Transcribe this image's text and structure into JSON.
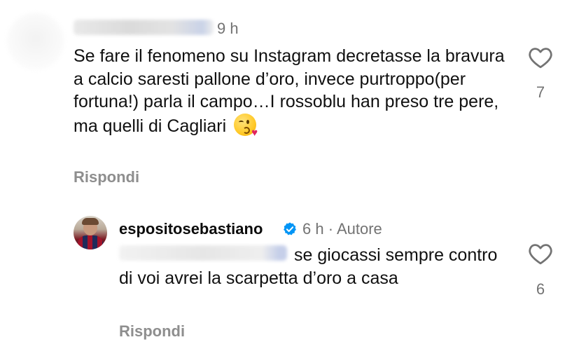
{
  "comments": [
    {
      "time": "9 h",
      "text": "Se fare il fenomeno su Instagram decretasse la bravura a calcio saresti pallone d’oro, invece purtroppo(per fortuna!) parla il campo…I rossoblu han preso tre pere, ma quelli di Cagliari",
      "emoji": "face-blowing-kiss",
      "reply_label": "Rispondi",
      "likes": "7"
    },
    {
      "username": "espositosebastiano",
      "verified": true,
      "time": "6 h",
      "author_tag": "Autore",
      "text": "se giocassi sempre contro di voi avrei la scarpetta d’oro a casa",
      "reply_label": "Rispondi",
      "likes": "6"
    }
  ],
  "icons": {
    "like": "heart-outline-icon",
    "verified": "verified-badge-icon"
  },
  "colors": {
    "text": "#101010",
    "muted": "#737373",
    "reply": "#8e8e8e",
    "verified": "#0095f6"
  }
}
